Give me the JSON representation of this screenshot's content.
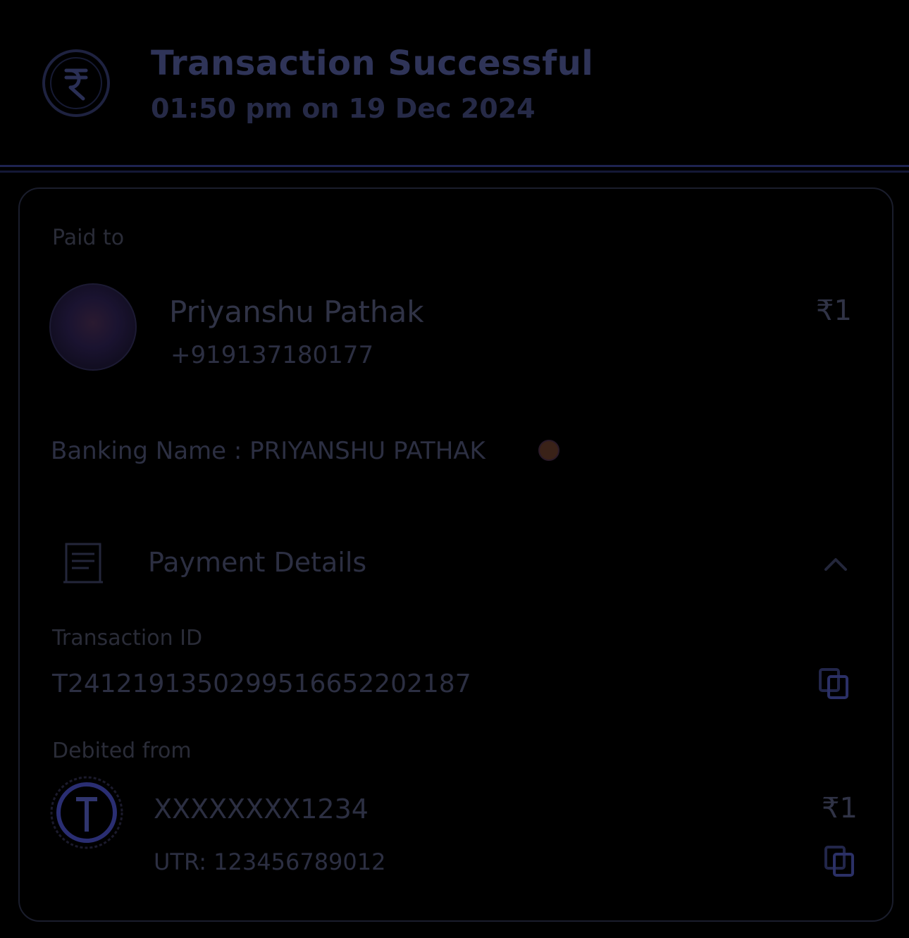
{
  "header": {
    "title": "Transaction Successful",
    "time": "01:50 pm on 19 Dec 2024",
    "icon": "rupee-check-icon"
  },
  "paid_to": {
    "label": "Paid to",
    "name": "Priyanshu Pathak",
    "phone": "+919137180177",
    "amount": "₹1"
  },
  "banking_name": {
    "text": "Banking Name : PRIYANSHU PATHAK",
    "verified_icon": "verified-badge-icon"
  },
  "payment_details": {
    "label": "Payment Details",
    "icon": "receipt-icon",
    "toggle_icon": "chevron-up-icon"
  },
  "transaction": {
    "label": "Transaction ID",
    "id": "T2412191350299516652202187",
    "copy_icon": "copy-icon"
  },
  "debited_from": {
    "label": "Debited from",
    "account": "XXXXXXXX1234",
    "amount": "₹1",
    "utr": "UTR: 123456789012",
    "copy_icon": "copy-icon"
  }
}
